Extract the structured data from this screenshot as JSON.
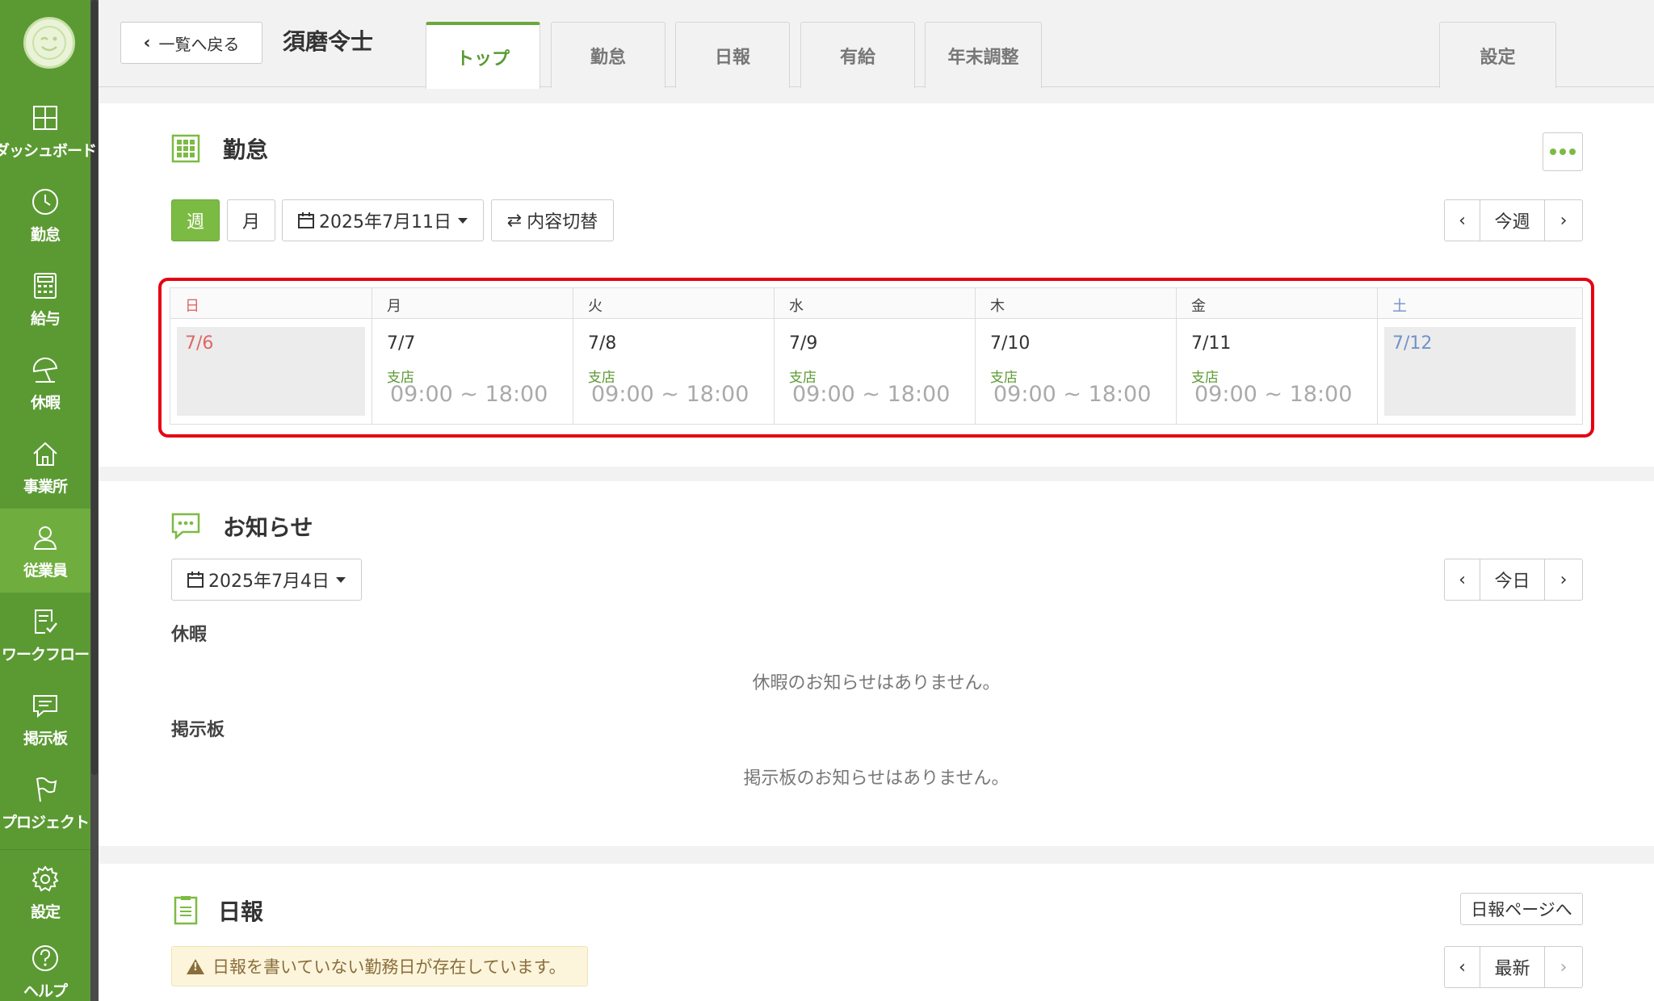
{
  "sidebar": {
    "items": [
      {
        "label": "ダッシュボード",
        "icon": "dashboard-icon"
      },
      {
        "label": "勤怠",
        "icon": "clock-icon"
      },
      {
        "label": "給与",
        "icon": "calculator-icon"
      },
      {
        "label": "休暇",
        "icon": "umbrella-icon"
      },
      {
        "label": "事業所",
        "icon": "home-icon"
      },
      {
        "label": "従業員",
        "icon": "person-icon"
      },
      {
        "label": "ワークフロー",
        "icon": "workflow-icon"
      },
      {
        "label": "掲示板",
        "icon": "message-icon"
      },
      {
        "label": "プロジェクト",
        "icon": "flag-icon"
      }
    ],
    "bottom": [
      {
        "label": "設定",
        "icon": "gear-icon"
      },
      {
        "label": "ヘルプ",
        "icon": "help-icon"
      }
    ],
    "accent": "#5b9a33"
  },
  "header": {
    "back_label": "一覧へ戻る",
    "title": "須磨令士",
    "tabs": [
      {
        "label": "トップ"
      },
      {
        "label": "勤怠"
      },
      {
        "label": "日報"
      },
      {
        "label": "有給"
      },
      {
        "label": "年末調整"
      }
    ],
    "settings_label": "設定"
  },
  "attendance": {
    "title": "勤怠",
    "week_label": "週",
    "month_label": "月",
    "date_label": "2025年7月11日",
    "switch_label": "内容切替",
    "prev": "‹",
    "current_label": "今週",
    "next": "›",
    "days": [
      {
        "dow": "日",
        "date": "7/6",
        "office": "",
        "time": ""
      },
      {
        "dow": "月",
        "date": "7/7",
        "office": "支店",
        "time": "09:00 ~ 18:00"
      },
      {
        "dow": "火",
        "date": "7/8",
        "office": "支店",
        "time": "09:00 ~ 18:00"
      },
      {
        "dow": "水",
        "date": "7/9",
        "office": "支店",
        "time": "09:00 ~ 18:00"
      },
      {
        "dow": "木",
        "date": "7/10",
        "office": "支店",
        "time": "09:00 ~ 18:00"
      },
      {
        "dow": "金",
        "date": "7/11",
        "office": "支店",
        "time": "09:00 ~ 18:00"
      },
      {
        "dow": "土",
        "date": "7/12",
        "office": "",
        "time": ""
      }
    ]
  },
  "notices": {
    "title": "お知らせ",
    "date_label": "2025年7月4日",
    "prev": "‹",
    "current_label": "今日",
    "next": "›",
    "leave_label": "休暇",
    "leave_empty": "休暇のお知らせはありません。",
    "board_label": "掲示板",
    "board_empty": "掲示板のお知らせはありません。"
  },
  "daily": {
    "title": "日報",
    "goto_label": "日報ページへ",
    "warning": "日報を書いていない勤務日が存在しています。",
    "prev": "‹",
    "current_label": "最新",
    "next": "›"
  }
}
